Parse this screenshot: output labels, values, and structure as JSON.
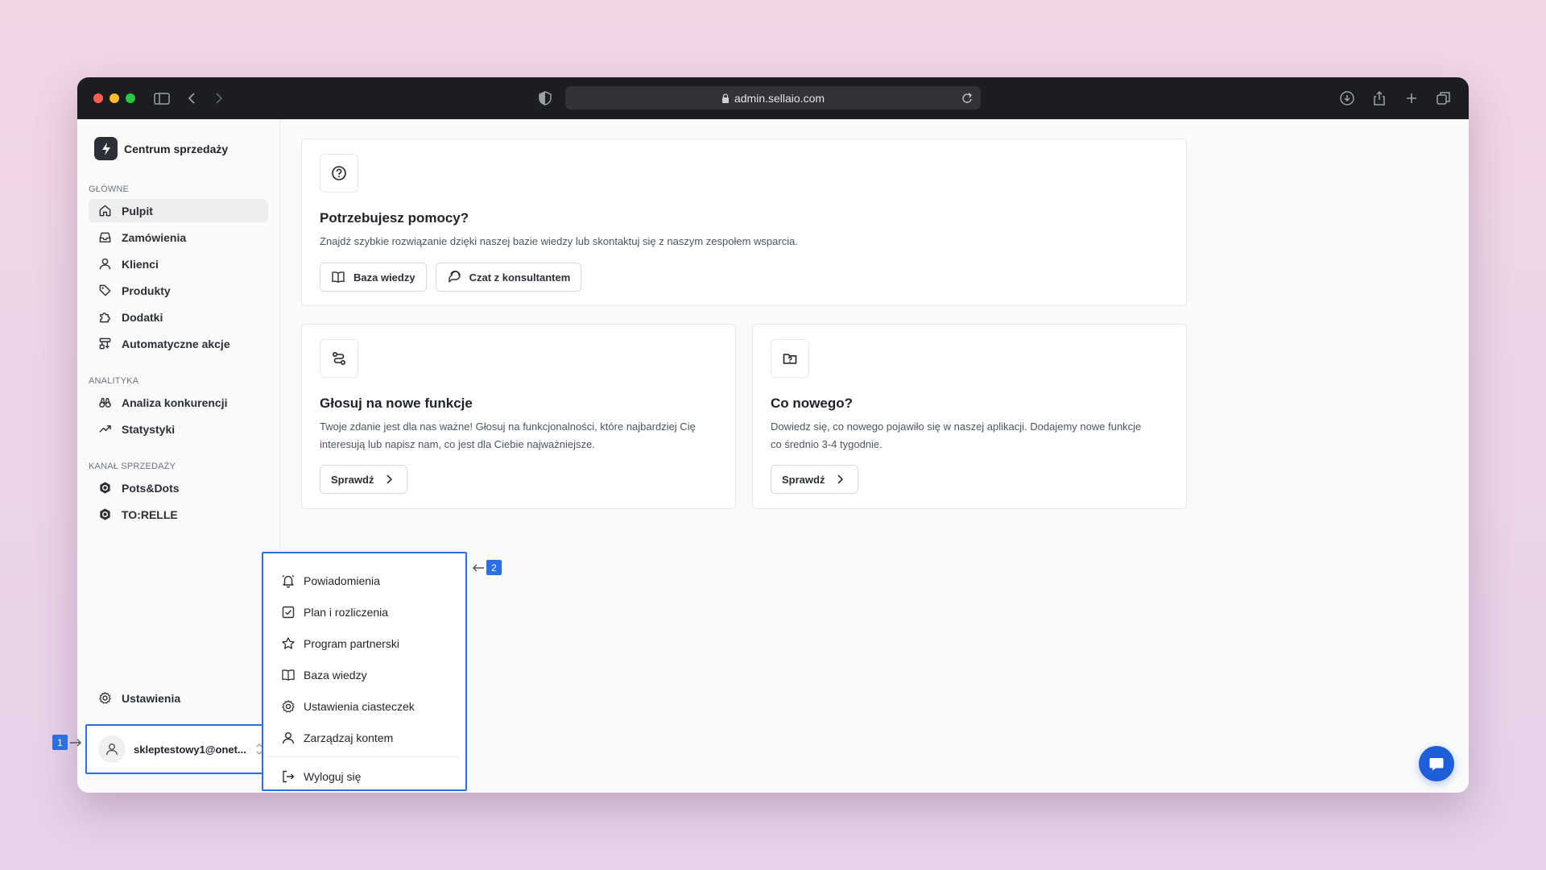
{
  "browser": {
    "url": "admin.sellaio.com"
  },
  "sidebar": {
    "brand": "Centrum sprzedaży",
    "sections": [
      {
        "label": "GŁÓWNE",
        "items": [
          {
            "label": "Pulpit",
            "icon": "home-icon"
          },
          {
            "label": "Zamówienia",
            "icon": "inbox-icon"
          },
          {
            "label": "Klienci",
            "icon": "user-icon"
          },
          {
            "label": "Produkty",
            "icon": "tag-icon"
          },
          {
            "label": "Dodatki",
            "icon": "puzzle-icon"
          },
          {
            "label": "Automatyczne akcje",
            "icon": "workflow-icon"
          }
        ]
      },
      {
        "label": "ANALITYKA",
        "items": [
          {
            "label": "Analiza konkurencji",
            "icon": "binoculars-icon"
          },
          {
            "label": "Statystyki",
            "icon": "trending-up-icon"
          }
        ]
      },
      {
        "label": "KANAŁ SPRZEDAŻY",
        "items": [
          {
            "label": "Pots&Dots",
            "icon": "channel-icon"
          },
          {
            "label": "TO:RELLE",
            "icon": "channel-icon"
          }
        ]
      }
    ],
    "settings_label": "Ustawienia",
    "user_email": "skleptestowy1@onet..."
  },
  "help_card": {
    "title": "Potrzebujesz pomocy?",
    "description": "Znajdź szybkie rozwiązanie dzięki naszej bazie wiedzy lub skontaktuj się z naszym zespołem wsparcia.",
    "btn_kb": "Baza wiedzy",
    "btn_chat": "Czat z konsultantem"
  },
  "vote_card": {
    "title": "Głosuj na nowe funkcje",
    "description_line1": "Twoje zdanie jest dla nas ważne! Głosuj na funkcjonalności, które najbardziej Cię",
    "description_line2": "interesują lub napisz nam, co jest dla Ciebie najważniejsze.",
    "button": "Sprawdź"
  },
  "news_card": {
    "title": "Co nowego?",
    "description_line1": "Dowiedz się, co nowego pojawiło się w naszej aplikacji. Dodajemy nowe funkcje",
    "description_line2": "co średnio 3-4 tygodnie.",
    "button": "Sprawdź"
  },
  "user_menu": {
    "items": [
      {
        "label": "Powiadomienia",
        "icon": "bell-icon"
      },
      {
        "label": "Plan i rozliczenia",
        "icon": "checkbox-icon"
      },
      {
        "label": "Program partnerski",
        "icon": "star-icon"
      },
      {
        "label": "Baza wiedzy",
        "icon": "book-icon"
      },
      {
        "label": "Ustawienia ciasteczek",
        "icon": "gear-icon"
      },
      {
        "label": "Zarządzaj kontem",
        "icon": "user-icon"
      }
    ],
    "logout": "Wyloguj się"
  },
  "callouts": {
    "one": "1",
    "two": "2"
  },
  "colors": {
    "accent": "#2b6fe3",
    "fab": "#1e5ed8"
  }
}
